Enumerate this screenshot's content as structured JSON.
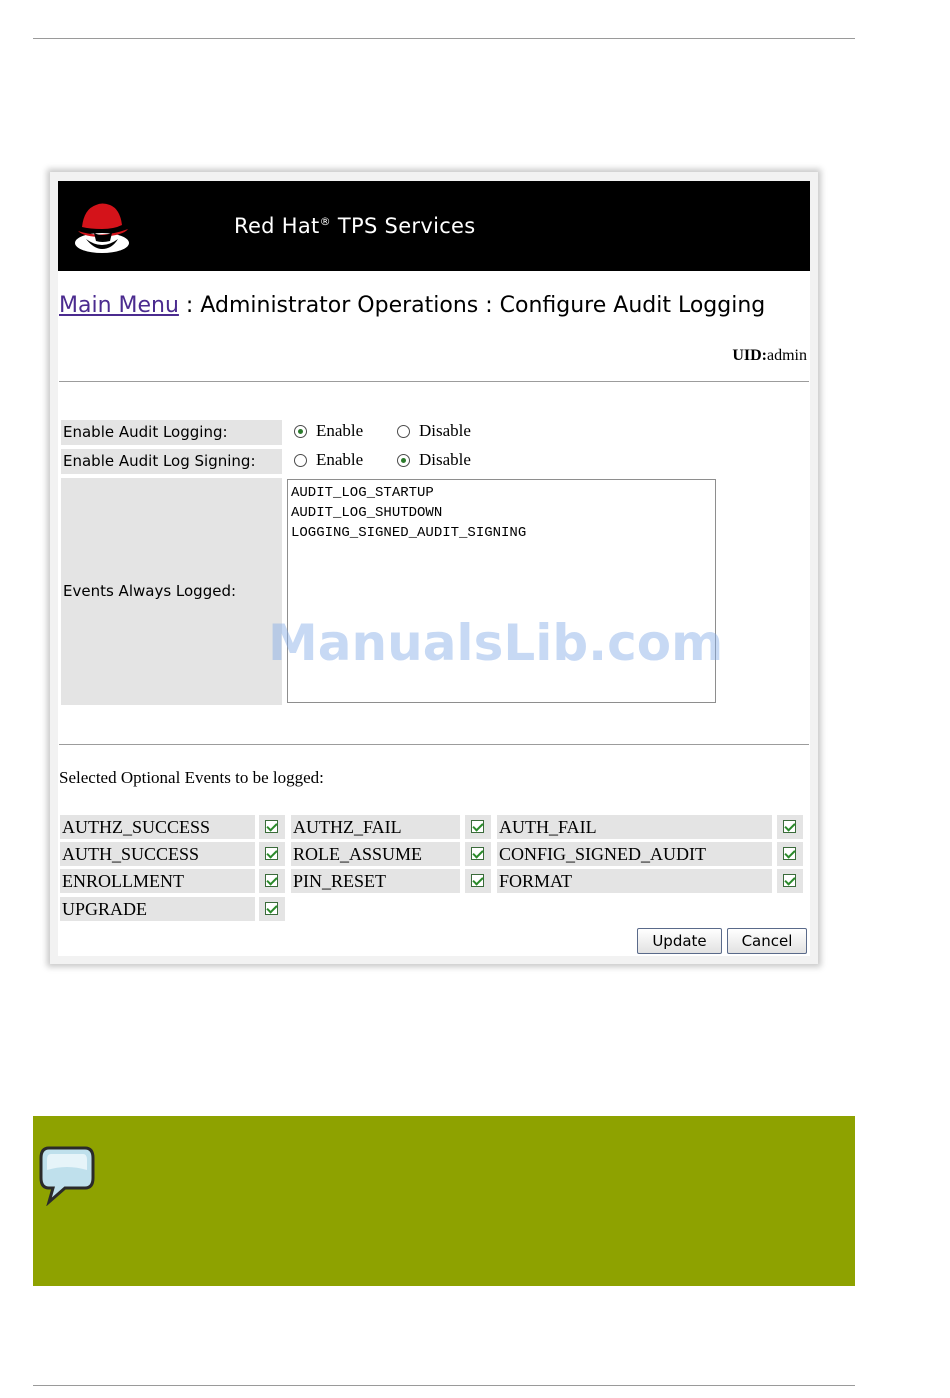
{
  "banner": {
    "brand": "Red Hat",
    "reg": "®",
    "service": " TPS Services"
  },
  "breadcrumb": {
    "main_menu": "Main Menu",
    "sep": " : ",
    "section": "Administrator Operations",
    "page": "Configure Audit Logging"
  },
  "uid": {
    "label": "UID:",
    "value": "admin"
  },
  "settings": {
    "enable_logging": {
      "label": "Enable Audit Logging:",
      "enable": "Enable",
      "disable": "Disable",
      "selected": "Enable"
    },
    "enable_signing": {
      "label": "Enable Audit Log Signing:",
      "enable": "Enable",
      "disable": "Disable",
      "selected": "Disable"
    },
    "always_logged": {
      "label": "Events Always Logged:",
      "events": [
        "AUDIT_LOG_STARTUP",
        "AUDIT_LOG_SHUTDOWN",
        "LOGGING_SIGNED_AUDIT_SIGNING"
      ]
    }
  },
  "optional": {
    "title": "Selected Optional Events to be logged:",
    "events": [
      {
        "name": "AUTHZ_SUCCESS",
        "checked": true
      },
      {
        "name": "AUTHZ_FAIL",
        "checked": true
      },
      {
        "name": "AUTH_FAIL",
        "checked": true
      },
      {
        "name": "AUTH_SUCCESS",
        "checked": true
      },
      {
        "name": "ROLE_ASSUME",
        "checked": true
      },
      {
        "name": "CONFIG_SIGNED_AUDIT",
        "checked": true
      },
      {
        "name": "ENROLLMENT",
        "checked": true
      },
      {
        "name": "PIN_RESET",
        "checked": true
      },
      {
        "name": "FORMAT",
        "checked": true
      },
      {
        "name": "UPGRADE",
        "checked": true
      }
    ]
  },
  "buttons": {
    "update": "Update",
    "cancel": "Cancel"
  },
  "watermark": "ManualsLib.com",
  "colors": {
    "banner": "#000000",
    "link": "#4b2b8f",
    "note_bg": "#8ea200",
    "cell_bg": "#e4e4e4"
  },
  "icons": {
    "logo": "redhat-shadowman-icon",
    "note": "speech-bubble-icon"
  }
}
